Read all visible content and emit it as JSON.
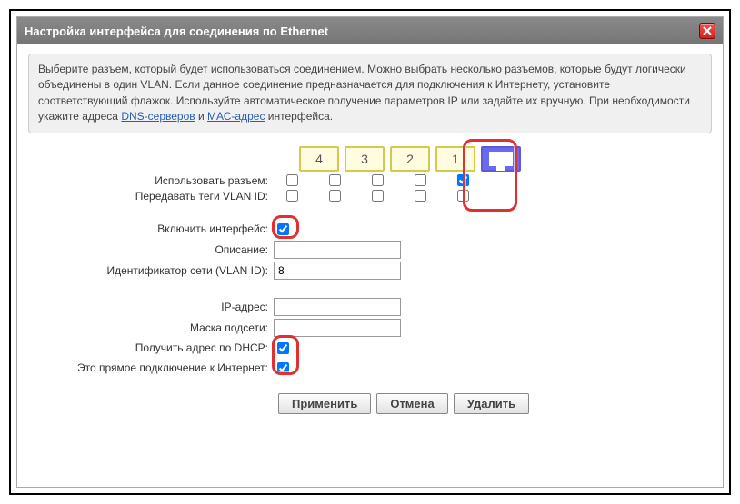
{
  "titlebar": {
    "title": "Настройка интерфейса для соединения по Ethernet"
  },
  "intro": {
    "text1": "Выберите разъем, который будет использоваться соединением. Можно выбрать несколько разъемов, которые будут логически объединены в один VLAN. Если данное соединение предназначается для подключения к Интернету, установите соответствующий флажок. Используйте автоматическое получение параметров IP или задайте их вручную. При необходимости укажите адреса ",
    "dns_link": "DNS-серверов",
    "text2": " и ",
    "mac_link": "МАС-адрес",
    "text3": " интерфейса."
  },
  "ports": {
    "labels": [
      "4",
      "3",
      "2",
      "1"
    ]
  },
  "rows": {
    "use_socket": "Использовать разъем:",
    "vlan_tags": "Передавать теги VLAN ID:",
    "enable_iface": "Включить интерфейс:",
    "description": "Описание:",
    "vlan_id": "Идентификатор сети (VLAN ID):",
    "ip": "IP-адрес:",
    "mask": "Маска подсети:",
    "dhcp": "Получить адрес по DHCP:",
    "inet": "Это прямое подключение к Интернет:"
  },
  "values": {
    "description": "",
    "vlan_id": "8",
    "ip": "",
    "mask": "",
    "use_socket_checked": [
      false,
      false,
      false,
      false,
      true
    ],
    "vlan_tags_checked": [
      false,
      false,
      false,
      false,
      false
    ],
    "enable_iface": true,
    "dhcp": true,
    "inet": true
  },
  "buttons": {
    "apply": "Применить",
    "cancel": "Отмена",
    "delete": "Удалить"
  }
}
